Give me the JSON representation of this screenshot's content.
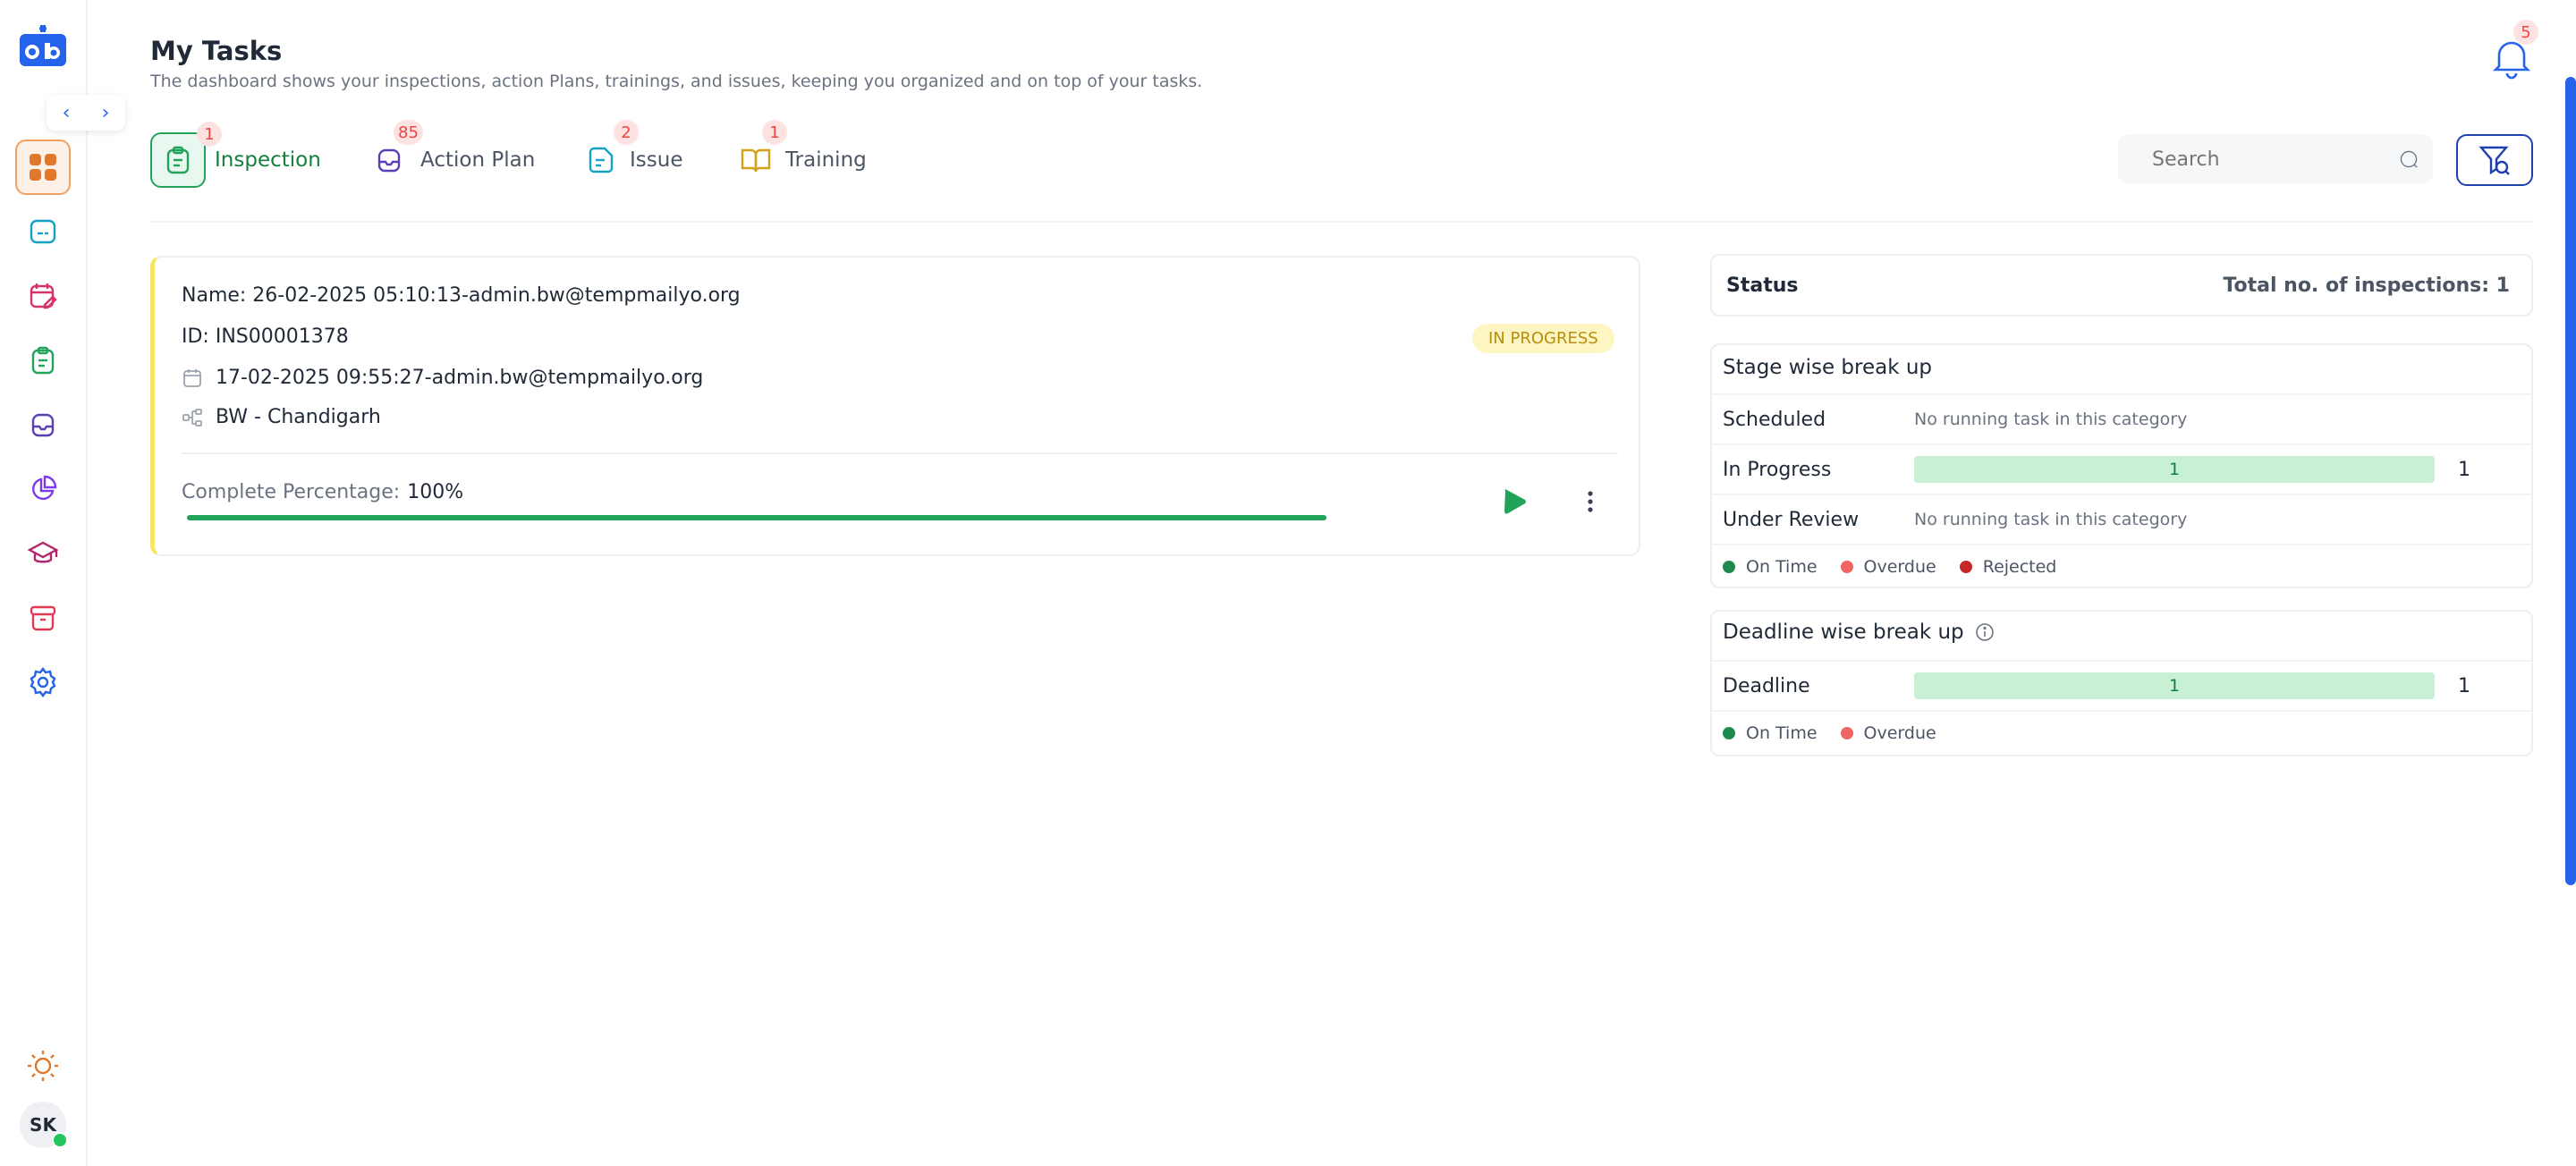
{
  "header": {
    "title": "My Tasks",
    "subtitle": "The dashboard shows your inspections, action Plans, trainings, and issues, keeping you organized and on top of your tasks.",
    "notification_count": "5"
  },
  "sidebar": {
    "items": [
      {
        "icon": "dashboard-grid-icon",
        "active": true
      },
      {
        "icon": "message-icon"
      },
      {
        "icon": "calendar-edit-icon"
      },
      {
        "icon": "clipboard-icon"
      },
      {
        "icon": "inbox-icon"
      },
      {
        "icon": "pie-chart-icon"
      },
      {
        "icon": "graduation-cap-icon"
      },
      {
        "icon": "archive-icon"
      },
      {
        "icon": "settings-icon"
      }
    ],
    "user_initials": "SK"
  },
  "tabs": [
    {
      "label": "Inspection",
      "badge": "1",
      "active": true,
      "color": "#22a35a"
    },
    {
      "label": "Action Plan",
      "badge": "85",
      "color": "#5b3fb5"
    },
    {
      "label": "Issue",
      "badge": "2",
      "color": "#14a3c7"
    },
    {
      "label": "Training",
      "badge": "1",
      "color": "#d4a017"
    }
  ],
  "search": {
    "placeholder": "Search"
  },
  "task": {
    "name": "Name: 26-02-2025 05:10:13-admin.bw@tempmailyo.org",
    "id": "ID: INS00001378",
    "status": "IN PROGRESS",
    "date_line": "17-02-2025 09:55:27-admin.bw@tempmailyo.org",
    "location": "BW - Chandigarh",
    "percentage_label": "Complete Percentage:",
    "percentage_value": "100%",
    "progress": 1.0
  },
  "status_panel": {
    "title": "Status",
    "total": "Total no. of inspections: 1",
    "stage": {
      "title": "Stage wise break up",
      "rows": [
        {
          "name": "Scheduled",
          "empty": "No running task in this category"
        },
        {
          "name": "In Progress",
          "bar_value": "1",
          "count": "1"
        },
        {
          "name": "Under Review",
          "empty": "No running task in this category"
        }
      ],
      "legend": [
        {
          "label": "On Time",
          "color": "#1e8a4c"
        },
        {
          "label": "Overdue",
          "color": "#f06464"
        },
        {
          "label": "Rejected",
          "color": "#c62828"
        }
      ]
    },
    "deadline": {
      "title": "Deadline wise break up",
      "rows": [
        {
          "name": "Deadline",
          "bar_value": "1",
          "count": "1"
        }
      ],
      "legend": [
        {
          "label": "On Time",
          "color": "#1e8a4c"
        },
        {
          "label": "Overdue",
          "color": "#f06464"
        }
      ]
    }
  }
}
